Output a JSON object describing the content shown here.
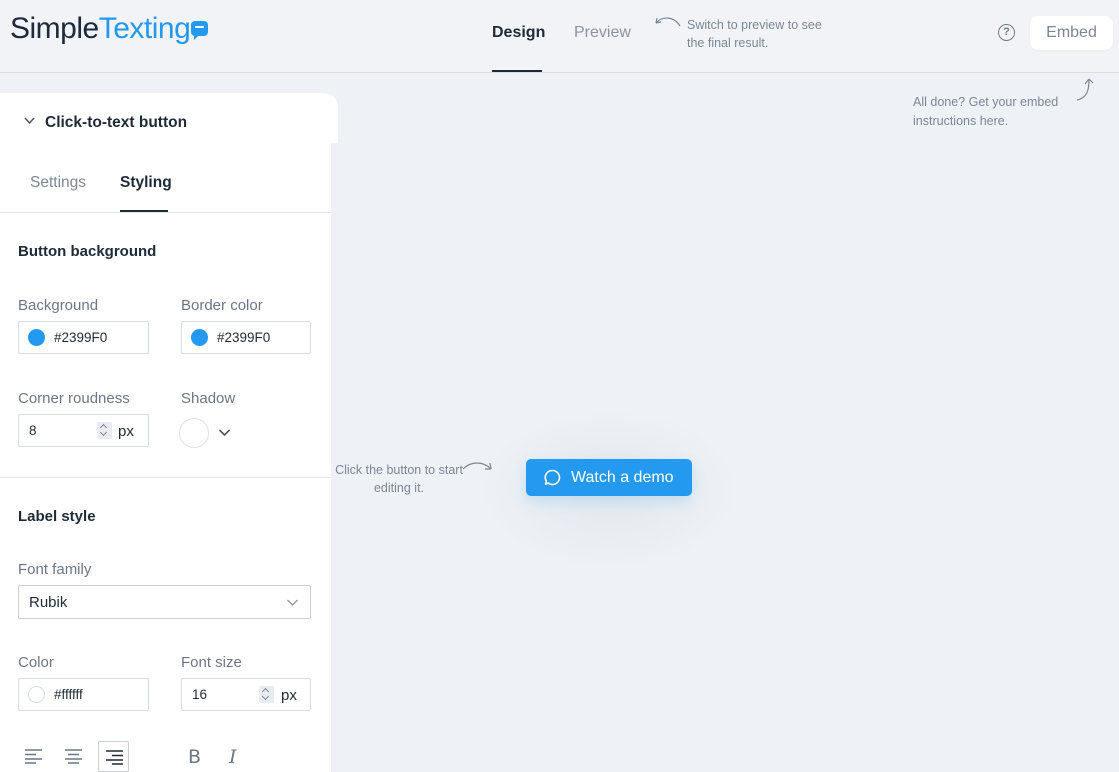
{
  "app": {
    "logo_simple": "Simple",
    "logo_texting": "Texting",
    "brand_color": "#2399F0"
  },
  "header": {
    "tabs": [
      {
        "label": "Design",
        "active": true
      },
      {
        "label": "Preview",
        "active": false
      }
    ],
    "preview_hint": "Switch to preview to see the final result.",
    "help_icon": "question-circle-icon",
    "help_symbol": "?",
    "embed_label": "Embed",
    "embed_hint": "All done? Get your embed instructions here."
  },
  "panel": {
    "title": "Click-to-text button",
    "tabs": [
      {
        "label": "Settings",
        "active": false
      },
      {
        "label": "Styling",
        "active": true
      }
    ],
    "button_background": {
      "section_title": "Button background",
      "background_label": "Background",
      "background_value": "#2399F0",
      "border_color_label": "Border color",
      "border_color_value": "#2399F0",
      "corner_roundness_label": "Corner roudness",
      "corner_roundness_value": "8",
      "corner_roundness_unit": "px",
      "shadow_label": "Shadow"
    },
    "label_style": {
      "section_title": "Label style",
      "font_family_label": "Font family",
      "font_family_value": "Rubik",
      "color_label": "Color",
      "color_value": "#ffffff",
      "font_size_label": "Font size",
      "font_size_value": "16",
      "font_size_unit": "px",
      "alignment_options": [
        "align-left",
        "align-center",
        "align-right"
      ],
      "alignment_selected": "align-right",
      "bold_glyph": "B",
      "italic_glyph": "I"
    }
  },
  "canvas": {
    "hint": "Click the button to start editing it.",
    "demo_button_label": "Watch a demo",
    "demo_button_icon": "chat-bubble-icon"
  }
}
